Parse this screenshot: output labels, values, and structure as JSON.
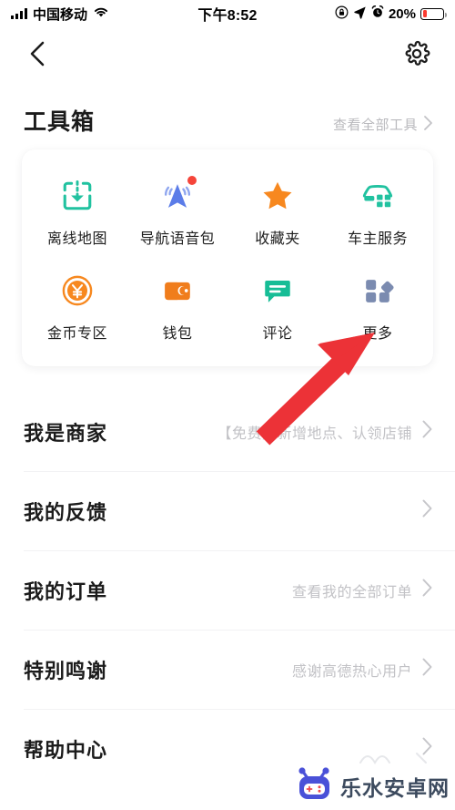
{
  "status_bar": {
    "carrier": "中国移动",
    "signal_icon": "signal-bars-icon",
    "wifi_icon": "wifi-icon",
    "time": "下午8:52",
    "lock_icon": "rotation-lock-icon",
    "location_icon": "location-arrow-icon",
    "alarm_icon": "alarm-clock-icon",
    "battery_percent": "20%",
    "battery_level": 20,
    "battery_color": "#fb3b30"
  },
  "navbar": {
    "back_icon": "back-chevron-icon",
    "settings_icon": "gear-icon"
  },
  "toolbox": {
    "title": "工具箱",
    "more_label": "查看全部工具",
    "more_chevron_icon": "chevron-right-icon",
    "tools": [
      {
        "label": "离线地图",
        "icon": "offline-map-download-icon",
        "color": "#21c2a0",
        "badge": false
      },
      {
        "label": "导航语音包",
        "icon": "navigation-voice-icon",
        "color": "#5b7ce8",
        "badge": true
      },
      {
        "label": "收藏夹",
        "icon": "star-favorites-icon",
        "color": "#f7881f",
        "badge": false
      },
      {
        "label": "车主服务",
        "icon": "car-service-icon",
        "color": "#21c2a0",
        "badge": false
      },
      {
        "label": "金币专区",
        "icon": "gold-coin-icon",
        "color": "#f7881f",
        "badge": false
      },
      {
        "label": "钱包",
        "icon": "wallet-icon",
        "color": "#f07d1c",
        "badge": false
      },
      {
        "label": "评论",
        "icon": "comment-bubble-icon",
        "color": "#17bd96",
        "badge": false
      },
      {
        "label": "更多",
        "icon": "more-grid-icon",
        "color": "#7b8bb0",
        "badge": false
      }
    ]
  },
  "menu": {
    "rows": [
      {
        "title": "我是商家",
        "subtitle": "【免费】新增地点、认领店铺",
        "chevron_icon": "chevron-right-icon"
      },
      {
        "title": "我的反馈",
        "subtitle": "",
        "chevron_icon": "chevron-right-icon"
      },
      {
        "title": "我的订单",
        "subtitle": "查看我的全部订单",
        "chevron_icon": "chevron-right-icon"
      },
      {
        "title": "特别鸣谢",
        "subtitle": "感谢高德热心用户",
        "chevron_icon": "chevron-right-icon"
      },
      {
        "title": "帮助中心",
        "subtitle": "",
        "chevron_icon": "chevron-right-icon"
      }
    ]
  },
  "annotation": {
    "arrow_icon": "red-pointer-arrow",
    "arrow_color": "#ec3237",
    "points_to": "更多"
  },
  "watermark": {
    "text": "乐水安卓网",
    "logo_icon": "robot-logo-icon",
    "logo_color": "#4a51d8"
  }
}
